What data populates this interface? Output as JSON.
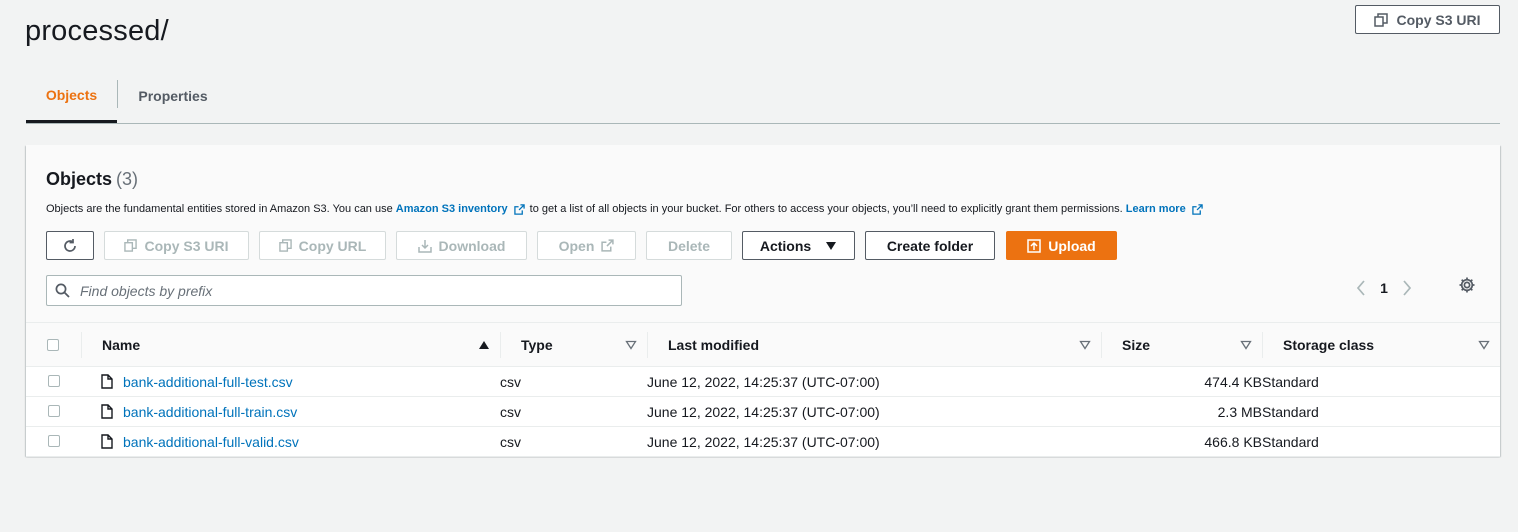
{
  "page": {
    "title": "processed/",
    "copy_s3_uri": "Copy S3 URI"
  },
  "tabs": [
    {
      "label": "Objects",
      "active": true
    },
    {
      "label": "Properties",
      "active": false
    }
  ],
  "panel": {
    "title": "Objects",
    "count": "(3)",
    "description_before": "Objects are the fundamental entities stored in Amazon S3. You can use",
    "inventory_link": "Amazon S3 inventory",
    "description_middle": "to get a list of all objects in your bucket. For others to access your objects, you’ll need to explicitly grant them permissions.",
    "learn_more": "Learn more"
  },
  "toolbar": {
    "copy_s3_uri": "Copy S3 URI",
    "copy_url": "Copy URL",
    "download": "Download",
    "open": "Open",
    "delete": "Delete",
    "actions": "Actions",
    "create_folder": "Create folder",
    "upload": "Upload"
  },
  "search": {
    "placeholder": "Find objects by prefix",
    "value": ""
  },
  "pagination": {
    "current_page": "1"
  },
  "table": {
    "columns": [
      "Name",
      "Type",
      "Last modified",
      "Size",
      "Storage class"
    ],
    "sort": {
      "column": "Name",
      "direction": "ascending"
    },
    "rows": [
      {
        "name": "bank-additional-full-test.csv",
        "type": "csv",
        "last_modified": "June 12, 2022, 14:25:37 (UTC-07:00)",
        "size": "474.4 KB",
        "storage_class": "Standard"
      },
      {
        "name": "bank-additional-full-train.csv",
        "type": "csv",
        "last_modified": "June 12, 2022, 14:25:37 (UTC-07:00)",
        "size": "2.3 MB",
        "storage_class": "Standard"
      },
      {
        "name": "bank-additional-full-valid.csv",
        "type": "csv",
        "last_modified": "June 12, 2022, 14:25:37 (UTC-07:00)",
        "size": "466.8 KB",
        "storage_class": "Standard"
      }
    ]
  },
  "colors": {
    "accent": "#ec7211",
    "link": "#0073bb",
    "text": "#16191f",
    "muted": "#545b64"
  },
  "icons": [
    "copy-icon",
    "refresh-icon",
    "download-icon",
    "external-link-icon",
    "caret-down-icon",
    "upload-icon",
    "search-icon",
    "chevron-left-icon",
    "chevron-right-icon",
    "settings-icon",
    "file-icon",
    "sort-up-icon",
    "sort-down-icon"
  ]
}
